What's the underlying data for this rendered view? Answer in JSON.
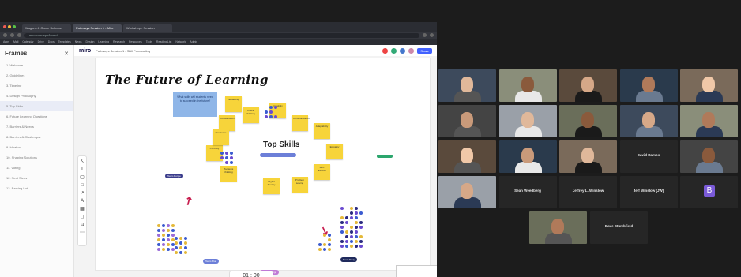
{
  "browser": {
    "tabs": [
      "Wagons & Game Scheme",
      "Pathways Session 1 - Miro",
      "Workshop - Session"
    ],
    "address": "miro.com/app/board/",
    "bookmarks": [
      "Apps",
      "Mail",
      "Calendar",
      "Drive",
      "Docs",
      "Templates",
      "News",
      "Design",
      "Learning",
      "Research",
      "Resources",
      "Tools",
      "Reading List",
      "Network",
      "Admin"
    ]
  },
  "frames_panel": {
    "title": "Frames",
    "items": [
      "1. Welcome",
      "2. Guidelines",
      "3. Timeline",
      "4. Design Philosophy",
      "5. Top Skills",
      "6. Future Learning Questions",
      "7. Barriers & Needs",
      "8. Barriers & Challenges",
      "9. Ideation",
      "10. Shaping Solutions",
      "11. Voting",
      "12. Next Steps",
      "13. Parking Lot"
    ],
    "selected_index": 4
  },
  "miro": {
    "logo": "miro",
    "board_name": "Pathways Session 1 - Skill Forecasting",
    "share_label": "Share",
    "title": "The Future of Learning",
    "blue_note": "What skills will students need to succeed in the future?",
    "center_label": "Top Skills",
    "stickies": [
      "Collaboration",
      "Critical thinking",
      "Creativity",
      "Communication",
      "Adaptability",
      "Empathy",
      "Self-direction",
      "Problem solving",
      "Digital literacy",
      "Systems thinking",
      "Curiosity",
      "Resilience",
      "Leadership"
    ],
    "pills": [
      "Team Purple",
      "Team Blue",
      "Team Orange",
      "Team Navy"
    ],
    "timer": "01 : 00",
    "colors": {
      "accent": "#4262ff",
      "sticky": "#f7d43a",
      "arrow": "#c81e4f",
      "blue_note": "#8fb6e8"
    }
  },
  "zoom": {
    "names_shown": [
      "David Ramos",
      "Sean Weedberg",
      "Jeffrey L. Winslow",
      "Jeff Winslow (JW)",
      "Dave Stumbfield"
    ],
    "avatar_letter": "B"
  }
}
